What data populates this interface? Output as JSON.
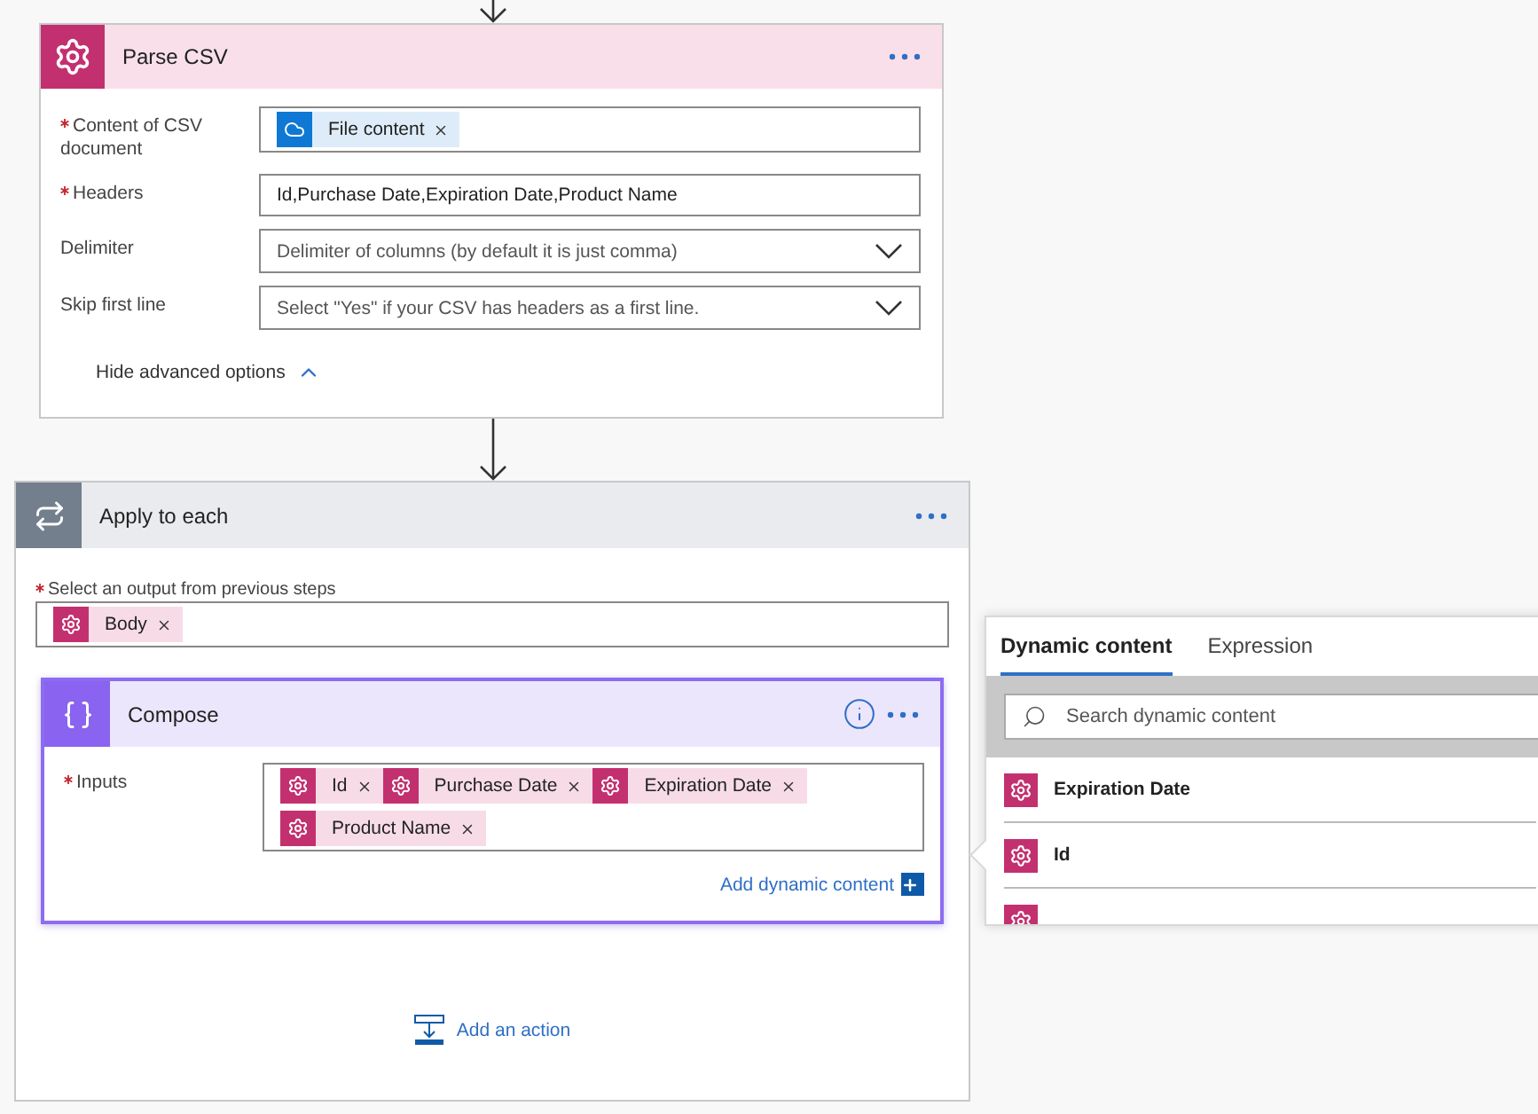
{
  "parse_csv": {
    "title": "Parse CSV",
    "fields": [
      {
        "label": "Content of CSV document",
        "required": true,
        "kind": "tokens",
        "tokens": [
          {
            "label": "File content",
            "kind": "file"
          }
        ]
      },
      {
        "label": "Headers",
        "required": true,
        "kind": "text",
        "value": "Id,Purchase Date,Expiration Date,Product Name"
      },
      {
        "label": "Delimiter",
        "required": false,
        "kind": "dropdown",
        "placeholder": "Delimiter of columns (by default it is just comma)"
      },
      {
        "label": "Skip first line",
        "required": false,
        "kind": "dropdown",
        "placeholder": "Select \"Yes\" if your CSV has headers as a first line."
      }
    ],
    "advanced_toggle": "Hide advanced options"
  },
  "apply_to_each": {
    "title": "Apply to each",
    "output_label": "Select an output from previous steps",
    "output_required": true,
    "output_tokens": [
      {
        "label": "Body",
        "kind": "action"
      }
    ],
    "compose": {
      "title": "Compose",
      "selected": true,
      "inputs_label": "Inputs",
      "inputs_required": true,
      "tokens": [
        {
          "label": "Id",
          "kind": "action"
        },
        {
          "label": "Purchase Date",
          "kind": "action"
        },
        {
          "label": "Expiration Date",
          "kind": "action"
        },
        {
          "label": "Product Name",
          "kind": "action"
        }
      ],
      "add_dynamic": "Add dynamic content"
    },
    "add_action": "Add an action"
  },
  "dynamic_panel": {
    "tabs": [
      {
        "label": "Dynamic content",
        "selected": true
      },
      {
        "label": "Expression",
        "selected": false
      }
    ],
    "search": {
      "placeholder": "Search dynamic content"
    },
    "items": [
      {
        "label": "Expiration Date"
      },
      {
        "label": "Id"
      }
    ]
  }
}
